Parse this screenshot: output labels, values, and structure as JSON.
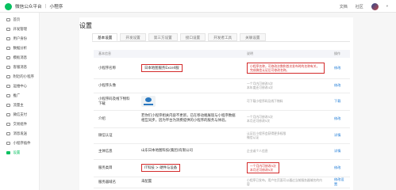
{
  "topbar": {
    "brand": "微信公众平台",
    "separator": "|",
    "product": "小程序",
    "links": [
      "文档",
      "社区"
    ]
  },
  "sidebar": {
    "items": [
      {
        "label": "首页",
        "icon": "home-icon",
        "active": false
      },
      {
        "label": "开发管理",
        "icon": "code-icon",
        "active": false
      },
      {
        "label": "用户身份",
        "icon": "user-icon",
        "active": false
      },
      {
        "label": "数据分析",
        "icon": "chart-icon",
        "active": false
      },
      {
        "label": "模板消息",
        "icon": "message-icon",
        "active": false
      },
      {
        "label": "客服消息",
        "icon": "service-icon",
        "active": false
      },
      {
        "label": "附近的小程序",
        "icon": "location-icon",
        "active": false
      },
      {
        "label": "运维中心",
        "icon": "ops-icon",
        "active": false
      },
      {
        "label": "推广",
        "icon": "promo-icon",
        "active": false
      },
      {
        "label": "流量主",
        "icon": "ad-icon",
        "active": false
      },
      {
        "label": "微信支付",
        "icon": "pay-icon",
        "active": false
      },
      {
        "label": "交易组件",
        "icon": "trade-icon",
        "active": false
      },
      {
        "label": "消息发送",
        "icon": "send-icon",
        "active": false
      },
      {
        "label": "小程序插件",
        "icon": "plugin-icon",
        "active": false
      },
      {
        "label": "设置",
        "icon": "settings-icon",
        "active": true
      }
    ]
  },
  "main": {
    "title": "设置",
    "tabs": [
      {
        "label": "基本设置",
        "active": true
      },
      {
        "label": "开发设置",
        "active": false
      },
      {
        "label": "第三方设置",
        "active": false
      },
      {
        "label": "接口设置",
        "active": false
      },
      {
        "label": "开发者工具",
        "active": false
      },
      {
        "label": "关联设置",
        "active": false
      }
    ],
    "table": {
      "headers": [
        "基本信息",
        "",
        "说明",
        "操作"
      ],
      "rows": [
        {
          "name": "小程序名称",
          "value": "日本地图服务Excell服",
          "desc": "小程序名称，可修改次数和首次发布时的名称有关，完成微信认证后可修改名称。",
          "op": "修改",
          "value_boxed": true,
          "desc_boxed": true,
          "kind": "text"
        },
        {
          "name": "小程序头像",
          "value": "",
          "desc": "一个月内可修改5次\n本年度还可修改4次",
          "op": "修改",
          "value_boxed": false,
          "desc_boxed": false,
          "kind": "avatar"
        },
        {
          "name": "小程序码及线下物料下载",
          "value": "",
          "desc": "可下载小程序码及线下物料",
          "op": "下载",
          "value_boxed": false,
          "desc_boxed": false,
          "kind": "qr"
        },
        {
          "name": "介绍",
          "value": "若你们小程序相关内容不更新，已在移动端展现与小程序数据相互同步，因为平台为消费提供的小程序的服务与体验。",
          "desc": "一个月内可修改5次\n本月还可修改5次",
          "op": "修改",
          "value_boxed": false,
          "desc_boxed": false,
          "kind": "text"
        },
        {
          "name": "微信认证",
          "value": "",
          "desc": "认证后小程序会获得更多权限\n微信认证",
          "op": "详情",
          "value_boxed": false,
          "desc_boxed": false,
          "kind": "text"
        },
        {
          "name": "主体信息",
          "value": "山东日本地图科技(集团)有限公司",
          "desc": "企业或个人信息",
          "op": "详情",
          "value_boxed": false,
          "desc_boxed": false,
          "kind": "text"
        },
        {
          "name": "服务类目",
          "value": "IT科技 > 硬件与设备",
          "desc": "一个月内可修改5次\n本月还可修改5次",
          "op": "修改",
          "value_boxed": true,
          "desc_boxed": true,
          "kind": "text"
        },
        {
          "name": "服务器域名",
          "value": "未配置",
          "desc": "小程序已发布，用户在页面可以通过当前服务器域名的内容",
          "op": "修改设置",
          "value_boxed": false,
          "desc_boxed": false,
          "kind": "text"
        }
      ]
    }
  },
  "colors": {
    "accent": "#07c160",
    "link": "#1e7bd6",
    "highlight_box": "#d32b2b"
  }
}
